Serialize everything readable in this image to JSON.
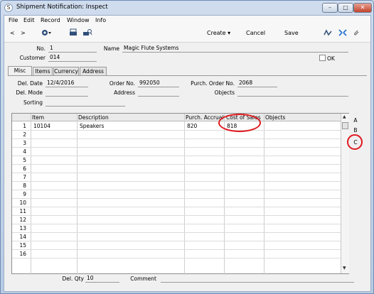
{
  "window": {
    "title": "Shipment Notification: Inspect",
    "min": "–",
    "max": "□",
    "close": "✕"
  },
  "menu": [
    "File",
    "Edit",
    "Record",
    "Window",
    "Info"
  ],
  "toolbar": {
    "prev": "<",
    "next": ">",
    "create": "Create",
    "cancel": "Cancel",
    "save": "Save"
  },
  "header": {
    "no_label": "No.",
    "no_value": "1",
    "name_label": "Name",
    "name_value": "Magic Flute Systems",
    "customer_label": "Customer",
    "customer_value": "014",
    "ok_label": "OK",
    "ok_checked": false
  },
  "tabs": [
    "Misc",
    "Items",
    "Currency",
    "Address"
  ],
  "misc": {
    "del_date_label": "Del. Date",
    "del_date_value": "12/4/2016",
    "order_no_label": "Order No.",
    "order_no_value": "992050",
    "purch_order_label": "Purch. Order No.",
    "purch_order_value": "2068",
    "del_mode_label": "Del. Mode",
    "del_mode_value": "",
    "address_label": "Address",
    "address_value": "",
    "objects_label": "Objects",
    "objects_value": "",
    "sorting_label": "Sorting",
    "sorting_value": ""
  },
  "grid": {
    "columns": [
      "Item",
      "Description",
      "Purch. Accrual",
      "Cost of Sales",
      "Objects"
    ],
    "rows": [
      {
        "n": "1",
        "item": "10104",
        "description": "Speakers",
        "accrual": "820",
        "cost": "818",
        "objects": ""
      },
      {
        "n": "2",
        "item": "",
        "description": "",
        "accrual": "",
        "cost": "",
        "objects": ""
      },
      {
        "n": "3",
        "item": "",
        "description": "",
        "accrual": "",
        "cost": "",
        "objects": ""
      },
      {
        "n": "4",
        "item": "",
        "description": "",
        "accrual": "",
        "cost": "",
        "objects": ""
      },
      {
        "n": "5",
        "item": "",
        "description": "",
        "accrual": "",
        "cost": "",
        "objects": ""
      },
      {
        "n": "6",
        "item": "",
        "description": "",
        "accrual": "",
        "cost": "",
        "objects": ""
      },
      {
        "n": "7",
        "item": "",
        "description": "",
        "accrual": "",
        "cost": "",
        "objects": ""
      },
      {
        "n": "8",
        "item": "",
        "description": "",
        "accrual": "",
        "cost": "",
        "objects": ""
      },
      {
        "n": "9",
        "item": "",
        "description": "",
        "accrual": "",
        "cost": "",
        "objects": ""
      },
      {
        "n": "10",
        "item": "",
        "description": "",
        "accrual": "",
        "cost": "",
        "objects": ""
      },
      {
        "n": "11",
        "item": "",
        "description": "",
        "accrual": "",
        "cost": "",
        "objects": ""
      },
      {
        "n": "12",
        "item": "",
        "description": "",
        "accrual": "",
        "cost": "",
        "objects": ""
      },
      {
        "n": "13",
        "item": "",
        "description": "",
        "accrual": "",
        "cost": "",
        "objects": ""
      },
      {
        "n": "14",
        "item": "",
        "description": "",
        "accrual": "",
        "cost": "",
        "objects": ""
      },
      {
        "n": "15",
        "item": "",
        "description": "",
        "accrual": "",
        "cost": "",
        "objects": ""
      },
      {
        "n": "16",
        "item": "",
        "description": "",
        "accrual": "",
        "cost": "",
        "objects": ""
      }
    ],
    "side_tabs": [
      "A",
      "B",
      "C"
    ],
    "scroll_up": "▲",
    "scroll_down": "▼"
  },
  "footer": {
    "del_qty_label": "Del. Qty",
    "del_qty_value": "10",
    "comment_label": "Comment",
    "comment_value": ""
  },
  "annotation_color": "#e0191f"
}
